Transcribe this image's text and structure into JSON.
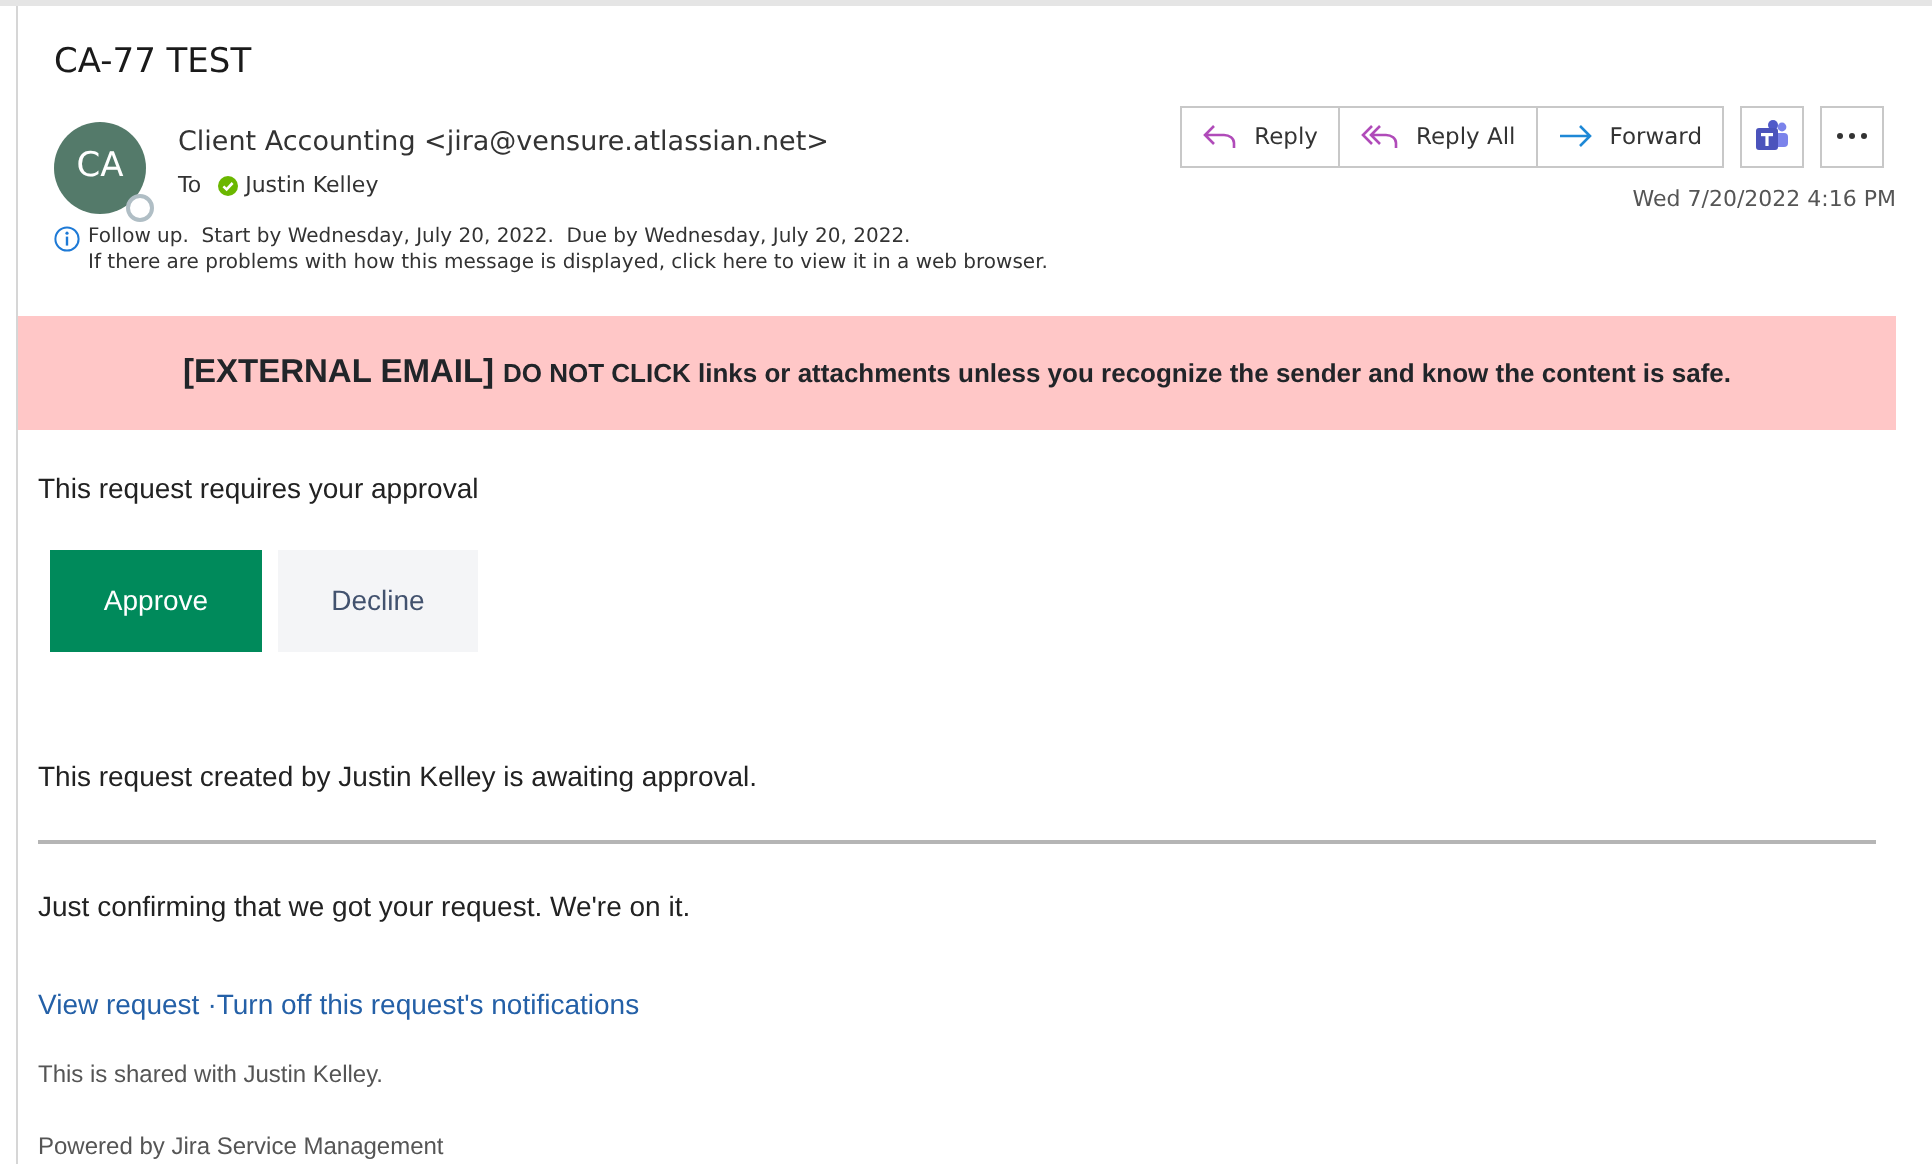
{
  "subject": "CA-77 TEST",
  "sender": {
    "initials": "CA",
    "name": "Client Accounting <jira@vensure.atlassian.net>",
    "to_label": "To",
    "recipient": "Justin Kelley",
    "date": "Wed 7/20/2022 4:16 PM"
  },
  "actions": [
    {
      "kind": "reply",
      "label": "Reply"
    },
    {
      "kind": "reply-all",
      "label": "Reply All"
    },
    {
      "kind": "forward",
      "label": "Forward"
    }
  ],
  "info": [
    "Follow up.  Start by Wednesday, July 20, 2022.  Due by Wednesday, July 20, 2022.",
    "If there are problems with how this message is displayed, click here to view it in a web browser."
  ],
  "banner": {
    "tag": "[EXTERNAL EMAIL]",
    "message": "DO NOT CLICK links or attachments unless you recognize the sender and know the content is safe."
  },
  "body": {
    "prompt": "This request requires your approval",
    "buttons": [
      {
        "kind": "approve",
        "label": "Approve"
      },
      {
        "kind": "decline",
        "label": "Decline"
      }
    ],
    "status": "This request created by Justin Kelley is awaiting approval.",
    "note": "Just confirming that we got your request. We're on it.",
    "links": [
      "View request",
      "·Turn off this request's notifications"
    ],
    "shared": "This is shared with Justin Kelley.",
    "footer": "Powered by Jira Service Management"
  }
}
